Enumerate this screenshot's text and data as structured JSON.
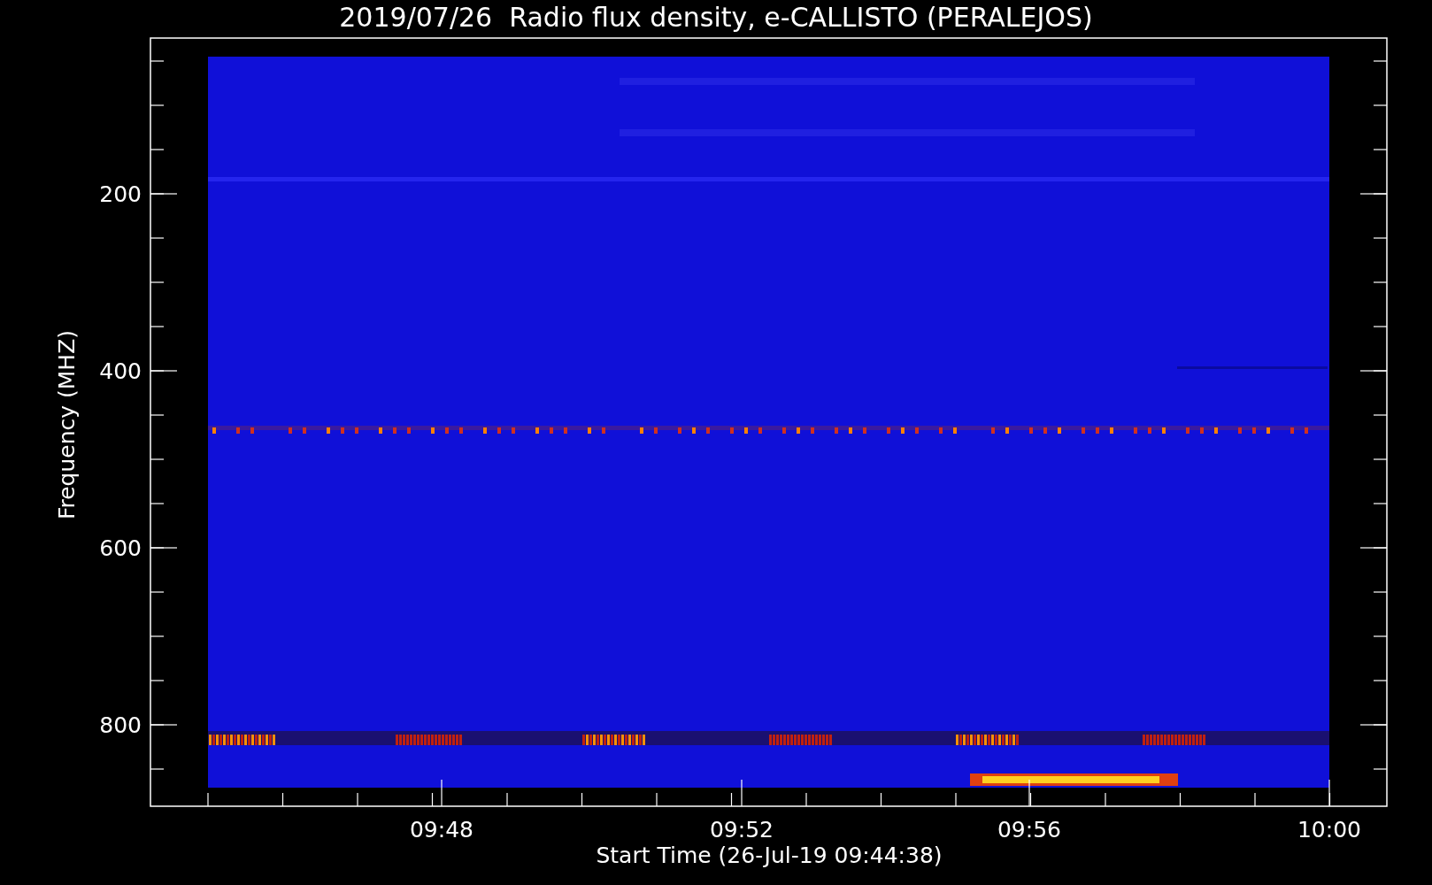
{
  "title": "2019/07/26  Radio flux density, e-CALLISTO (PERALEJOS)",
  "y_axis": {
    "label": "Frequency (MHZ)",
    "ticks": [
      "200",
      "400",
      "600",
      "800"
    ]
  },
  "x_axis": {
    "label": "Start Time (26-Jul-19 09:44:38)",
    "ticks": [
      "09:48",
      "09:52",
      "09:56",
      "10:00"
    ]
  }
}
